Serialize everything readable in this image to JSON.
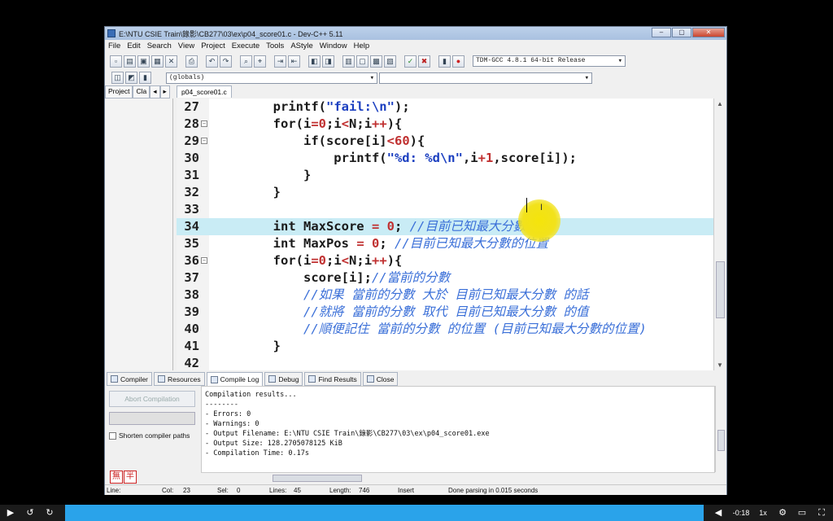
{
  "window": {
    "title": "E:\\NTU CSIE Train\\錄影\\CB277\\03\\ex\\p04_score01.c - Dev-C++ 5.11"
  },
  "menu": [
    "File",
    "Edit",
    "Search",
    "View",
    "Project",
    "Execute",
    "Tools",
    "AStyle",
    "Window",
    "Help"
  ],
  "toolbar": {
    "compiler_select": "TDM-GCC 4.8.1 64-bit Release",
    "scope_select": "(globals)"
  },
  "left_tabs": [
    "Project",
    "Cla"
  ],
  "editor_tab": "p04_score01.c",
  "code_lines": [
    {
      "n": "27",
      "fold": "",
      "tokens": [
        [
          "",
          "        printf("
        ],
        [
          "str",
          "\"fail:\\n\""
        ],
        [
          "",
          ");"
        ]
      ]
    },
    {
      "n": "28",
      "fold": "⊟",
      "tokens": [
        [
          "",
          "        for(i"
        ],
        [
          "op",
          "="
        ],
        [
          "num",
          "0"
        ],
        [
          "",
          ";i"
        ],
        [
          "op",
          "<"
        ],
        [
          "",
          "N;i"
        ],
        [
          "op",
          "++"
        ],
        [
          "",
          "){"
        ]
      ]
    },
    {
      "n": "29",
      "fold": "⊟",
      "tokens": [
        [
          "",
          "            if(score[i]"
        ],
        [
          "op",
          "<"
        ],
        [
          "num",
          "60"
        ],
        [
          "",
          "){"
        ]
      ]
    },
    {
      "n": "30",
      "fold": "",
      "tokens": [
        [
          "",
          "                printf("
        ],
        [
          "str",
          "\"%d: %d\\n\""
        ],
        [
          "",
          ",i"
        ],
        [
          "op",
          "+"
        ],
        [
          "num",
          "1"
        ],
        [
          "",
          ",score[i]);"
        ]
      ]
    },
    {
      "n": "31",
      "fold": "",
      "tokens": [
        [
          "",
          "            }"
        ]
      ]
    },
    {
      "n": "32",
      "fold": "",
      "tokens": [
        [
          "",
          "        }"
        ]
      ]
    },
    {
      "n": "33",
      "fold": "",
      "tokens": [
        [
          "",
          ""
        ]
      ]
    },
    {
      "n": "34",
      "fold": "",
      "tokens": [
        [
          "",
          "        int MaxScore "
        ],
        [
          "op",
          "="
        ],
        [
          "",
          " "
        ],
        [
          "num",
          "0"
        ],
        [
          "",
          "; "
        ],
        [
          "cm",
          "//目前已知最大分數"
        ]
      ]
    },
    {
      "n": "35",
      "fold": "",
      "tokens": [
        [
          "",
          "        int MaxPos "
        ],
        [
          "op",
          "="
        ],
        [
          "",
          " "
        ],
        [
          "num",
          "0"
        ],
        [
          "",
          "; "
        ],
        [
          "cm",
          "//目前已知最大分數的位置"
        ]
      ]
    },
    {
      "n": "36",
      "fold": "⊟",
      "tokens": [
        [
          "",
          "        for(i"
        ],
        [
          "op",
          "="
        ],
        [
          "num",
          "0"
        ],
        [
          "",
          ";i"
        ],
        [
          "op",
          "<"
        ],
        [
          "",
          "N;i"
        ],
        [
          "op",
          "++"
        ],
        [
          "",
          "){"
        ]
      ]
    },
    {
      "n": "37",
      "fold": "",
      "tokens": [
        [
          "",
          "            score[i];"
        ],
        [
          "cm",
          "//當前的分數"
        ]
      ]
    },
    {
      "n": "38",
      "fold": "",
      "tokens": [
        [
          "cm",
          "            //如果 當前的分數 大於 目前已知最大分數 的話"
        ]
      ]
    },
    {
      "n": "39",
      "fold": "",
      "tokens": [
        [
          "cm",
          "            //就將 當前的分數 取代 目前已知最大分數 的值"
        ]
      ]
    },
    {
      "n": "40",
      "fold": "",
      "tokens": [
        [
          "cm",
          "            //順便記住 當前的分數 的位置 (目前已知最大分數的位置)"
        ]
      ]
    },
    {
      "n": "41",
      "fold": "",
      "tokens": [
        [
          "",
          "        }"
        ]
      ]
    },
    {
      "n": "42",
      "fold": "",
      "tokens": [
        [
          "",
          ""
        ]
      ]
    }
  ],
  "bottom_tabs": [
    "Compiler",
    "Resources",
    "Compile Log",
    "Debug",
    "Find Results",
    "Close"
  ],
  "bottom_left": {
    "abort": "Abort Compilation",
    "shorten": "Shorten compiler paths",
    "logo": [
      "無",
      "半"
    ]
  },
  "log_lines": [
    "Compilation results...",
    "--------",
    "- Errors: 0",
    "- Warnings: 0",
    "- Output Filename: E:\\NTU CSIE Train\\錄影\\CB277\\03\\ex\\p04_score01.exe",
    "- Output Size: 128.2705078125 KiB",
    "- Compilation Time: 0.17s"
  ],
  "status": {
    "line": "Line:",
    "col": "Col:",
    "col_val": "23",
    "sel": "Sel:",
    "sel_val": "0",
    "lines": "Lines:",
    "lines_val": "45",
    "length": "Length:",
    "length_val": "746",
    "mode": "Insert",
    "message": "Done parsing in 0.015 seconds"
  },
  "player": {
    "time": "-0:18",
    "speed": "1x"
  }
}
